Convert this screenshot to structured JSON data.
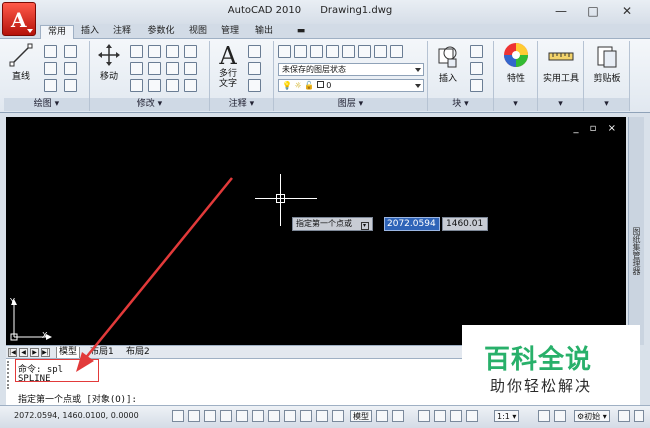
{
  "window": {
    "app_name": "AutoCAD 2010",
    "doc_name": "Drawing1.dwg",
    "minimize": "—",
    "maximize": "□",
    "close": "✕"
  },
  "app_menu": {
    "glyph": "A",
    "icon": "autocad-logo-icon"
  },
  "tabs": [
    {
      "label": "常用",
      "active": true
    },
    {
      "label": "插入"
    },
    {
      "label": "注释"
    },
    {
      "label": "参数化"
    },
    {
      "label": "视图"
    },
    {
      "label": "管理"
    },
    {
      "label": "输出"
    }
  ],
  "ribbon": {
    "draw": {
      "line_label": "直线",
      "panel_label": "绘图 ▾"
    },
    "modify": {
      "move_label": "移动",
      "panel_label": "修改 ▾"
    },
    "annotation": {
      "mtext_label": "多行\n文字",
      "mtext_short": "多行",
      "mtext_short2": "文字",
      "panel_label": "注释 ▾"
    },
    "layers": {
      "layer_state": "未保存的图层状态",
      "layer_name": "0",
      "panel_label": "图层 ▾"
    },
    "block": {
      "insert_label": "插入",
      "panel_label": "块 ▾"
    },
    "properties": {
      "label": "特性"
    },
    "utilities": {
      "label": "实用工具"
    },
    "clipboard": {
      "label": "剪贴板"
    },
    "accent_color": "#2f64b8"
  },
  "drawing": {
    "background": "#000000",
    "viewport_controls": "_ ▫ ×",
    "dynamic_prompt": "指定第一个点或",
    "dynamic_x": "2072.0594",
    "dynamic_y": "1460.01",
    "ucs_x": "X",
    "ucs_y": "Y"
  },
  "palette_strip": {
    "label": "图纸集管理器"
  },
  "layout_tabs": [
    {
      "label": "模型",
      "active": true
    },
    {
      "label": "布局1"
    },
    {
      "label": "布局2"
    }
  ],
  "command_line": {
    "line1": "命令: spl",
    "line2": "SPLINE",
    "line3": "指定第一个点或 [对象(O)]:"
  },
  "statusbar": {
    "coords": "2072.0594, 1460.0100, 0.0000",
    "model_label": "模型",
    "scale": "1:1 ▾",
    "workspace": "初始 ▾"
  },
  "annotation": {
    "color": "#e23a3a"
  },
  "watermark": {
    "title": "百科全说",
    "subtitle": "助你轻松解决",
    "title_color": "#28b06a"
  }
}
